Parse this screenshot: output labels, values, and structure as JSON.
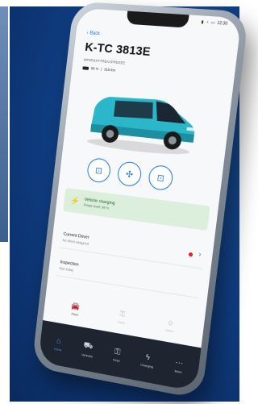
{
  "status_bar": {
    "time": "12:30",
    "icons": [
      "signal-icon",
      "wifi-icon",
      "battery-icon"
    ]
  },
  "header": {
    "back_label": "Back",
    "plate": "K-TC 3813E",
    "vin": "WF0RXXTTRBAAPREEEE",
    "meta": [
      "98 %",
      "|",
      "318 km"
    ]
  },
  "vehicle": {
    "body_color": "#2bb6c9"
  },
  "lock_buttons": [
    {
      "name": "unlock",
      "icon": "unlock-icon"
    },
    {
      "name": "climate",
      "icon": "fan-icon"
    },
    {
      "name": "lock",
      "icon": "lock-icon"
    }
  ],
  "charging": {
    "title": "Vehicle charging",
    "subtitle": "Power level: 98 %"
  },
  "rows": [
    {
      "title": "Current Driver",
      "subtitle": "No driver assigned",
      "alert": true
    },
    {
      "title": "Inspection",
      "subtitle": "Due today",
      "alert": false
    }
  ],
  "mini_tabs": [
    {
      "label": "Fleet",
      "active": true
    },
    {
      "label": "Keys",
      "active": false
    },
    {
      "label": "Users",
      "active": false
    }
  ],
  "bottom_nav": [
    {
      "label": "Home",
      "active": true
    },
    {
      "label": "Vehicles",
      "active": false
    },
    {
      "label": "Keys",
      "active": false
    },
    {
      "label": "Charging",
      "active": false
    },
    {
      "label": "More",
      "active": false
    }
  ],
  "colors": {
    "accent": "#1a73e8",
    "charge_bg": "#dcefdc",
    "alert": "#e31b23",
    "nav_bg": "#1e2530",
    "nav_active": "#3aa0ff"
  }
}
